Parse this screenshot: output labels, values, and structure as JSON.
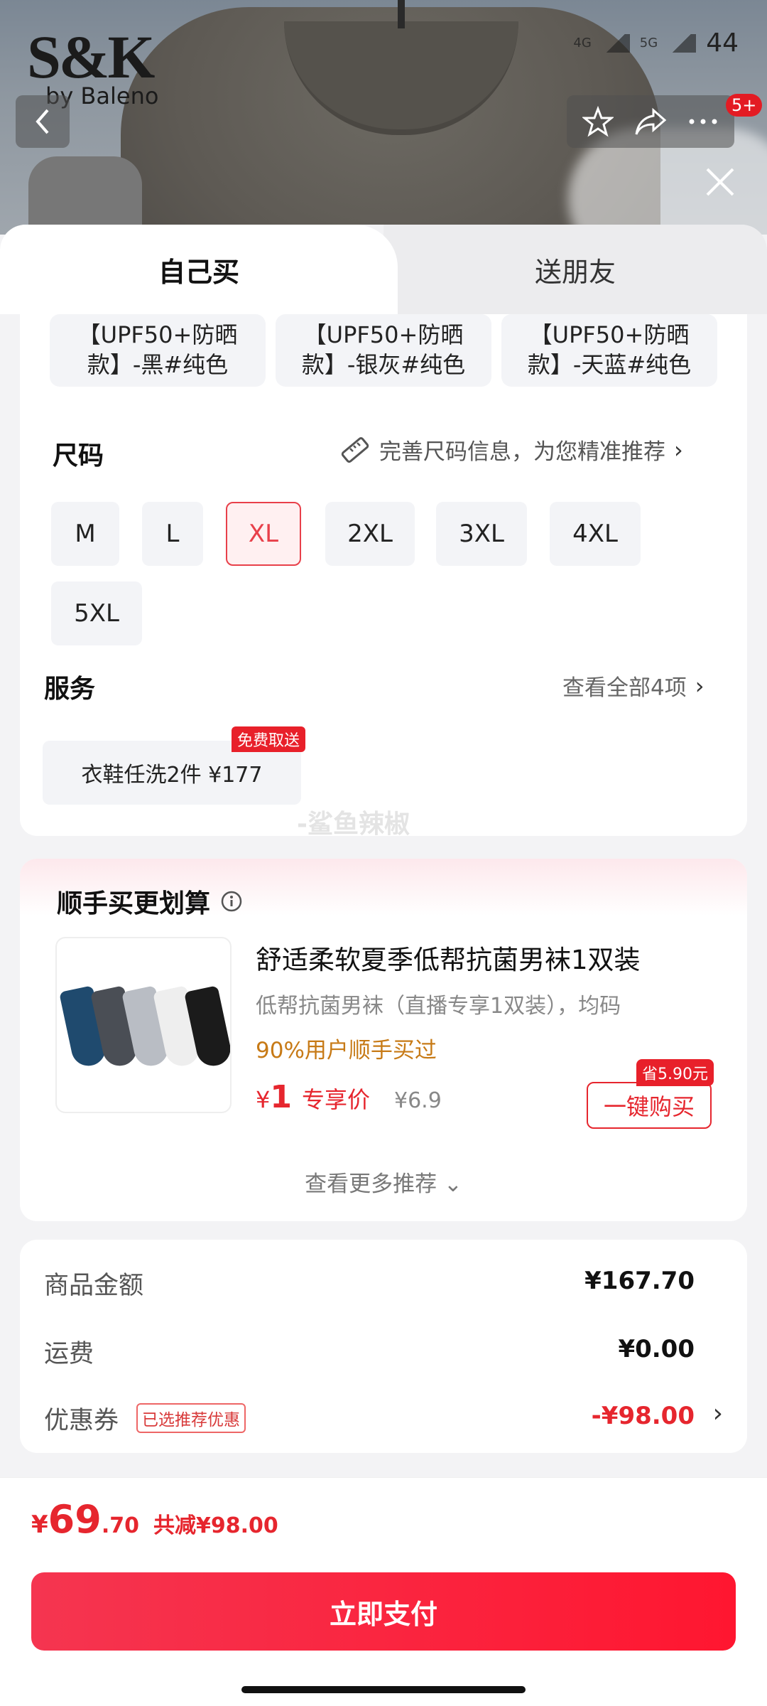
{
  "brand": {
    "logo": "S&K",
    "by": "by Baleno"
  },
  "status_bar": {
    "net1": "4G",
    "net2": "5G",
    "battery": "44"
  },
  "header": {
    "cart_badge": "5+"
  },
  "tabs": {
    "self": "自己买",
    "friend": "送朋友"
  },
  "colors": [
    {
      "line1": "【UPF50+防晒",
      "line2": "款】-黑#纯色"
    },
    {
      "line1": "【UPF50+防晒",
      "line2": "款】-银灰#纯色"
    },
    {
      "line1": "【UPF50+防晒",
      "line2": "款】-天蓝#纯色"
    }
  ],
  "size": {
    "title": "尺码",
    "hint": "完善尺码信息，为您精准推荐",
    "options": [
      "M",
      "L",
      "XL",
      "2XL",
      "3XL",
      "4XL",
      "5XL"
    ],
    "selected": "XL"
  },
  "service": {
    "title": "服务",
    "see_all": "查看全部4项",
    "item": "衣鞋任洗2件  ¥177",
    "tag": "免费取送"
  },
  "watermark": "-鲨鱼辣椒",
  "upsell": {
    "title": "顺手买更划算",
    "product_title": "舒适柔软夏季低帮抗菌男袜1双装",
    "product_sub": "低帮抗菌男袜（直播专享1双装），均码",
    "rate": "90%用户顺手买过",
    "price_symbol": "¥",
    "price": "1",
    "price_label": "专享价",
    "old_price": "¥6.9",
    "save_tag": "省5.90元",
    "buy_button": "一键购买",
    "see_more": "查看更多推荐 ⌄"
  },
  "summary": {
    "goods_label": "商品金额",
    "goods_value": "¥167.70",
    "shipping_label": "运费",
    "shipping_value": "¥0.00",
    "coupon_label": "优惠券",
    "coupon_tag": "已选推荐优惠",
    "coupon_value": "-¥98.00"
  },
  "footer": {
    "currency": "¥",
    "total_int": "69",
    "total_dec": ".70",
    "reduce": "共减¥98.00",
    "pay_button": "立即支付"
  },
  "theme": {
    "accent": "#e6262e",
    "pay_gradient_start": "#f53550",
    "pay_gradient_end": "#ff1630"
  }
}
